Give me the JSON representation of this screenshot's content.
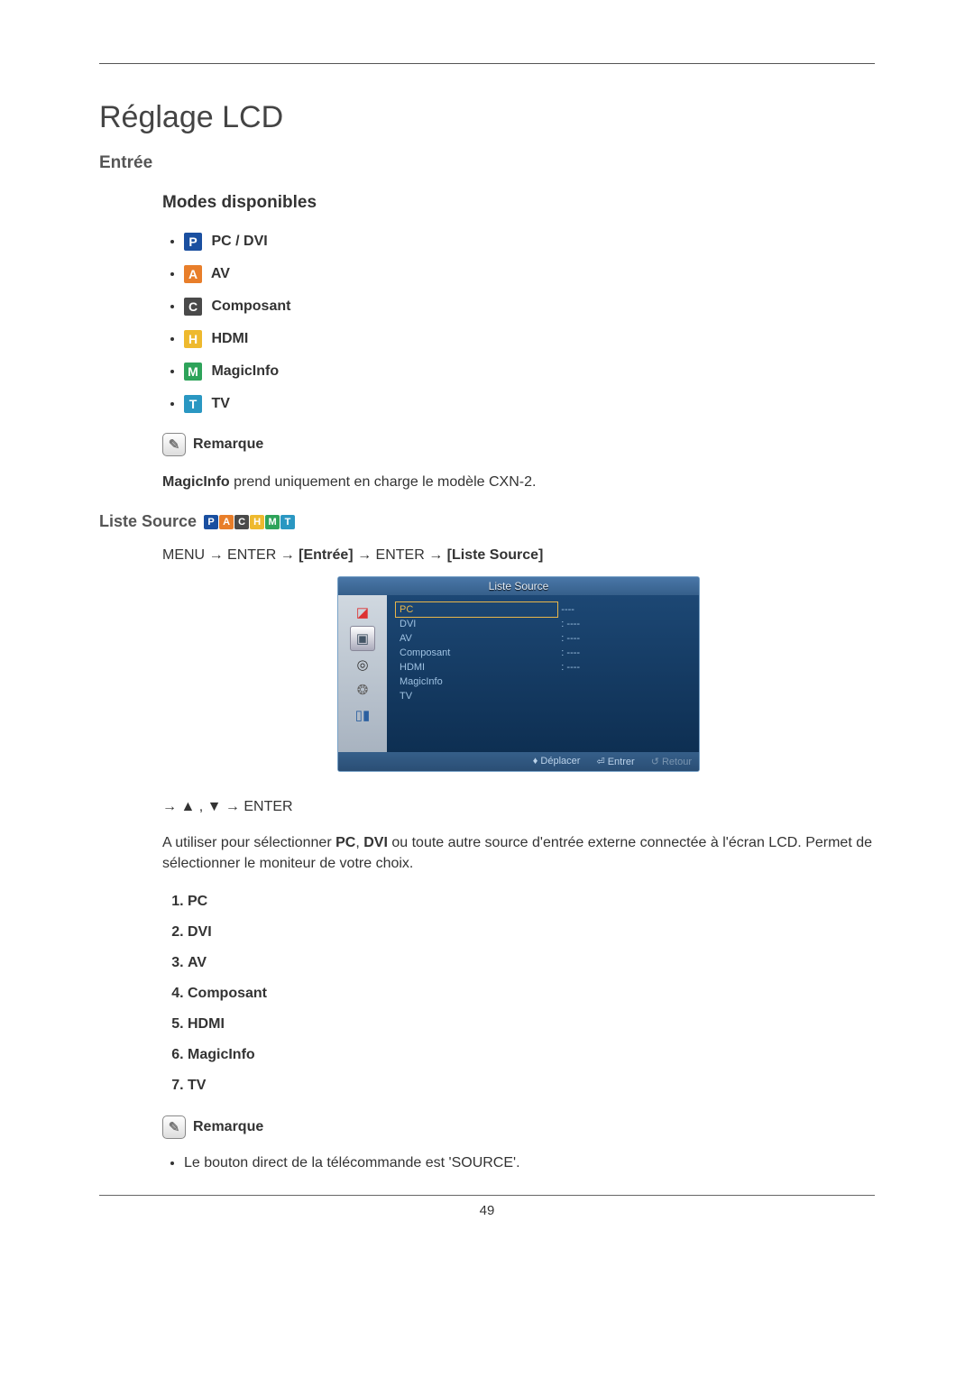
{
  "page_number": "49",
  "title": "Réglage LCD",
  "section_entry": "Entrée",
  "modes_heading": "Modes disponibles",
  "modes": [
    {
      "badge": "P",
      "cls": "icon-p",
      "label": "PC / DVI"
    },
    {
      "badge": "A",
      "cls": "icon-a",
      "label": "AV"
    },
    {
      "badge": "C",
      "cls": "icon-c",
      "label": "Composant"
    },
    {
      "badge": "H",
      "cls": "icon-h",
      "label": "HDMI"
    },
    {
      "badge": "M",
      "cls": "icon-m",
      "label": "MagicInfo"
    },
    {
      "badge": "T",
      "cls": "icon-t",
      "label": "TV"
    }
  ],
  "note_label": "Remarque",
  "note1_prefix": "MagicInfo",
  "note1_rest": " prend uniquement en charge le modèle CXN-2.",
  "liste_source_heading": "Liste Source",
  "badge_strip": [
    {
      "t": "P",
      "cls": "icon-p"
    },
    {
      "t": "A",
      "cls": "icon-a"
    },
    {
      "t": "C",
      "cls": "icon-c"
    },
    {
      "t": "H",
      "cls": "icon-h"
    },
    {
      "t": "M",
      "cls": "icon-m"
    },
    {
      "t": "T",
      "cls": "icon-t"
    }
  ],
  "nav": {
    "menu": "MENU",
    "enter": "ENTER",
    "arrow": "→",
    "bracket1": "[Entrée]",
    "bracket2": "[Liste Source]"
  },
  "osd": {
    "title": "Liste Source",
    "rows": [
      {
        "name": "PC",
        "val": "----",
        "selected": true
      },
      {
        "name": "DVI",
        "val": ": ----"
      },
      {
        "name": "AV",
        "val": ": ----"
      },
      {
        "name": "Composant",
        "val": ": ----"
      },
      {
        "name": "HDMI",
        "val": ": ----"
      },
      {
        "name": "MagicInfo",
        "val": ""
      },
      {
        "name": "TV",
        "val": ""
      }
    ],
    "foot": {
      "move": "Déplacer",
      "enter": "Entrer",
      "return": "Retour"
    }
  },
  "arrow_nav_line": "→ ▲ , ▼ → ENTER",
  "para_prefix": "A utiliser pour sélectionner ",
  "para_bold1": "PC",
  "para_mid": ", ",
  "para_bold2": "DVI",
  "para_rest": " ou toute autre source d'entrée externe connectée à l'écran LCD. Permet de sélectionner le moniteur de votre choix.",
  "numlist": [
    "PC",
    "DVI",
    "AV",
    "Composant",
    "HDMI",
    "MagicInfo",
    "TV"
  ],
  "note2_bullet": "Le bouton direct de la télécommande est 'SOURCE'."
}
